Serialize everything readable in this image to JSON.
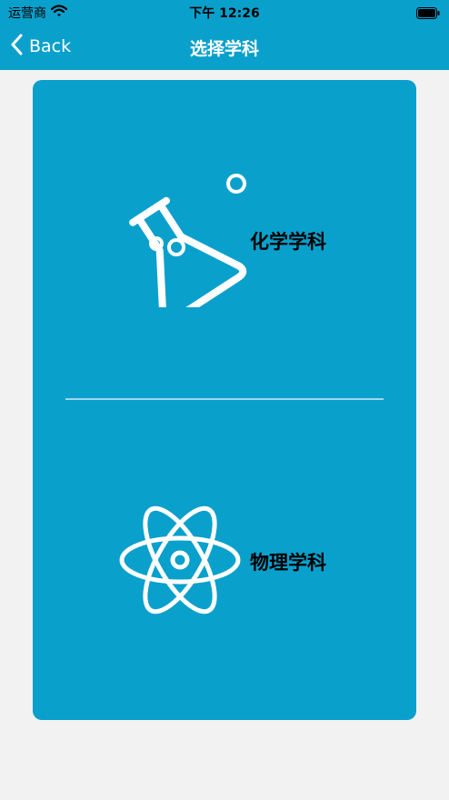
{
  "status_bar": {
    "carrier": "运营商",
    "time": "下午 12:26"
  },
  "nav": {
    "back_label": "Back",
    "title": "选择学科"
  },
  "subjects": [
    {
      "label": "化学学科",
      "icon": "flask-icon"
    },
    {
      "label": "物理学科",
      "icon": "atom-icon"
    }
  ],
  "colors": {
    "accent": "#0aa0cc",
    "background": "#f2f2f2",
    "icon": "#ffffff",
    "divider": "#9fd6ea"
  }
}
